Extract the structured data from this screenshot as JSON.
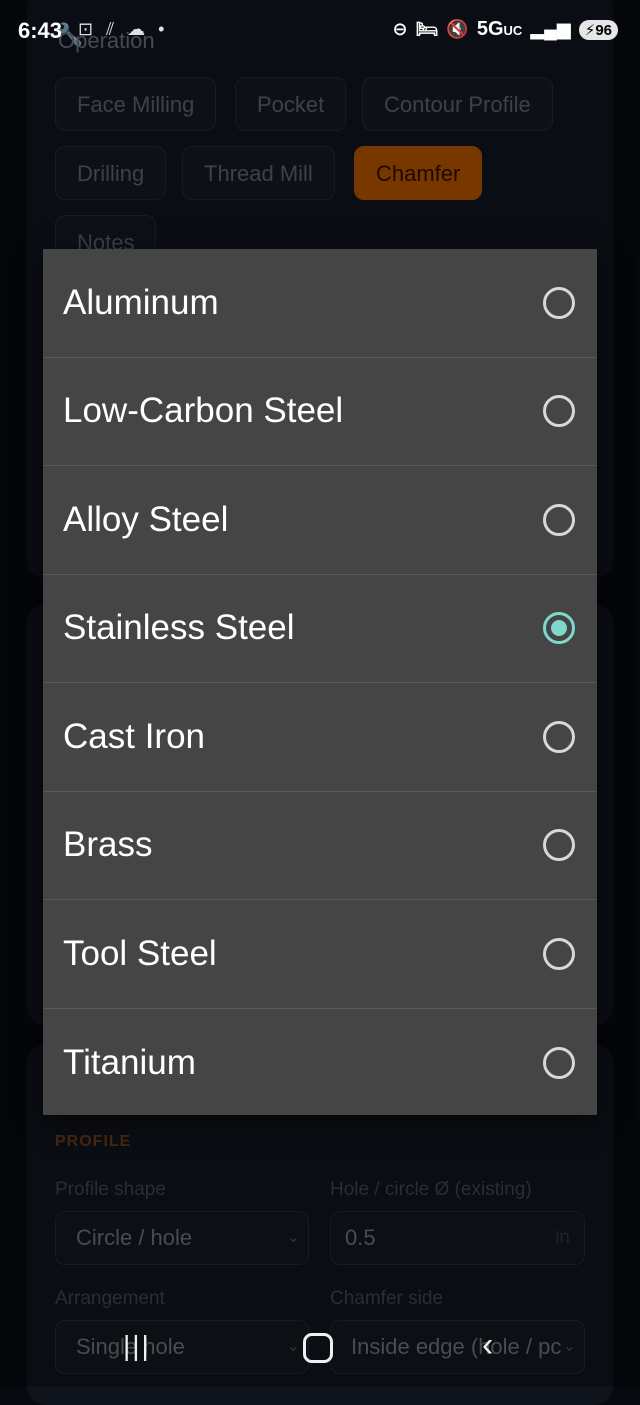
{
  "status_bar": {
    "time": "6:43",
    "left_icons": "⊡ ⫽ ☁ •",
    "network": "5G",
    "network_sub": "UC",
    "battery": "96"
  },
  "operation": {
    "title": "Operation",
    "chips": [
      {
        "label": "Face Milling",
        "active": false
      },
      {
        "label": "Pocket",
        "active": false
      },
      {
        "label": "Contour Profile",
        "active": false
      },
      {
        "label": "Drilling",
        "active": false
      },
      {
        "label": "Thread Mill",
        "active": false
      },
      {
        "label": "Chamfer",
        "active": true
      },
      {
        "label": "Notes",
        "active": false
      }
    ]
  },
  "profile": {
    "section_label": "PROFILE",
    "shape_label": "Profile shape",
    "shape_value": "Circle / hole",
    "hole_label": "Hole / circle Ø (existing)",
    "hole_value": "0.5",
    "hole_unit": "in",
    "arrangement_label": "Arrangement",
    "arrangement_value": "Single hole",
    "side_label": "Chamfer side",
    "side_value": "Inside edge (hole / pc"
  },
  "material_dialog": {
    "selected": "Stainless Steel",
    "options": [
      {
        "label": "Aluminum",
        "checked": false
      },
      {
        "label": "Low-Carbon Steel",
        "checked": false
      },
      {
        "label": "Alloy Steel",
        "checked": false
      },
      {
        "label": "Stainless Steel",
        "checked": true
      },
      {
        "label": "Cast Iron",
        "checked": false
      },
      {
        "label": "Brass",
        "checked": false
      },
      {
        "label": "Tool Steel",
        "checked": false
      },
      {
        "label": "Titanium",
        "checked": false
      }
    ]
  },
  "colors": {
    "accent": "#b35100",
    "radio_selected": "#7fd8cc",
    "dialog_bg": "#454545"
  },
  "icons": {
    "operation": "wrench-icon",
    "chevron": "chevron-down-icon",
    "nav_recent": "recents-icon",
    "nav_home": "home-icon",
    "nav_back": "back-icon"
  }
}
